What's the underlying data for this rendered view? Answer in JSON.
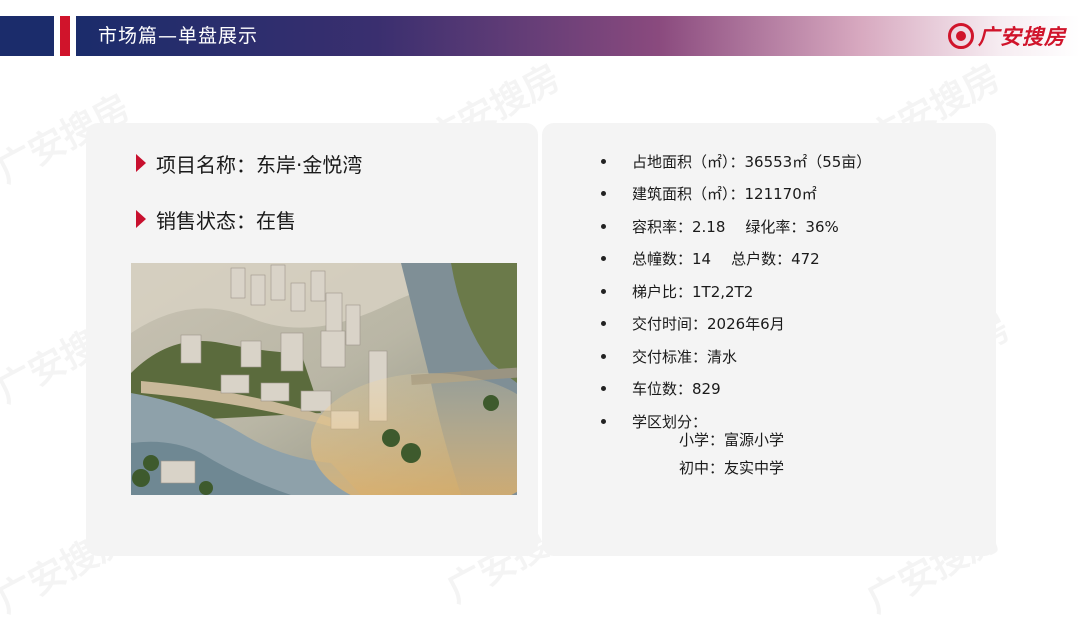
{
  "header": {
    "title": "市场篇—单盘展示",
    "logo_text": "广安搜房",
    "logo_mark_icon": "fang-logo-icon"
  },
  "watermark": {
    "text": "广安搜房"
  },
  "colors": {
    "navy": "#1b2c6b",
    "red": "#d0142b",
    "panel": "#f4f4f4"
  },
  "project": {
    "name_line": "项目名称：东岸·金悦湾",
    "status_line": "销售状态：在售"
  },
  "facts": {
    "land_area": "占地面积（㎡）：36553㎡（55亩）",
    "build_area": "建筑面积（㎡）：121170㎡",
    "plot_ratio": "容积率：2.18",
    "green_ratio": "绿化率：36%",
    "buildings": "总幢数：14",
    "households": "总户数：472",
    "elevator_ratio": "梯户比：1T2,2T2",
    "delivery_time": "交付时间：2026年6月",
    "delivery_standard": "交付标准：清水",
    "parking": "车位数：829",
    "school_district": "学区划分："
  },
  "schools": {
    "primary": "小学：富源小学",
    "middle": "初中：友实中学"
  }
}
